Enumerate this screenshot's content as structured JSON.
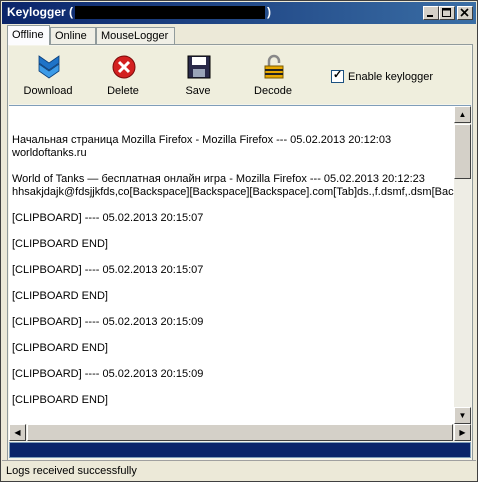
{
  "window": {
    "title": "Keylogger (",
    "title_suffix": ")"
  },
  "tabs": [
    {
      "label": "Offline",
      "active": true
    },
    {
      "label": "Online",
      "active": false
    },
    {
      "label": "MouseLogger",
      "active": false
    }
  ],
  "toolbar": {
    "download_label": "Download",
    "delete_label": "Delete",
    "save_label": "Save",
    "decode_label": "Decode",
    "enable_keylogger_label": "Enable keylogger",
    "enable_keylogger_checked": true
  },
  "log": {
    "lines": [
      "Начальная страница Mozilla Firefox - Mozilla Firefox --- 05.02.2013 20:12:03",
      "worldoftanks.ru",
      "",
      "World of Tanks — бесплатная онлайн игра - Mozilla Firefox --- 05.02.2013 20:12:23",
      "hhsakjdajk@fdsjjkfds,co[Backspace][Backspace][Backspace].com[Tab]ds.,f.dsmf,.dsm[Backspace]",
      "",
      "[CLIPBOARD] ---- 05.02.2013 20:15:07",
      "",
      "[CLIPBOARD END]",
      "",
      "[CLIPBOARD] ---- 05.02.2013 20:15:07",
      "",
      "[CLIPBOARD END]",
      "",
      "[CLIPBOARD] ---- 05.02.2013 20:15:09",
      "",
      "[CLIPBOARD END]",
      "",
      "[CLIPBOARD] ---- 05.02.2013 20:15:09",
      "",
      "[CLIPBOARD END]"
    ]
  },
  "progress": {
    "fraction": 1.0
  },
  "status": {
    "text": "Logs received successfully"
  },
  "colors": {
    "titlebar": "#0a246a",
    "progress": "#0a246a",
    "download_icon": "#1e73c8",
    "delete_icon": "#d32020"
  }
}
